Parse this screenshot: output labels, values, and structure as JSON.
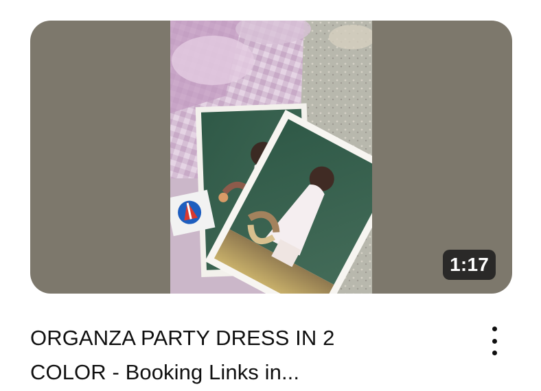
{
  "video": {
    "duration": "1:17",
    "title_line1": "ORGANZA PARTY DRESS IN 2",
    "title_line2": "COLOR - Booking Links in..."
  },
  "icons": {
    "menu": "more-vert-icon"
  },
  "colors": {
    "thumbnail_background": "#7d786c",
    "duration_badge": "#232323",
    "title_text": "#0f0f0f"
  }
}
